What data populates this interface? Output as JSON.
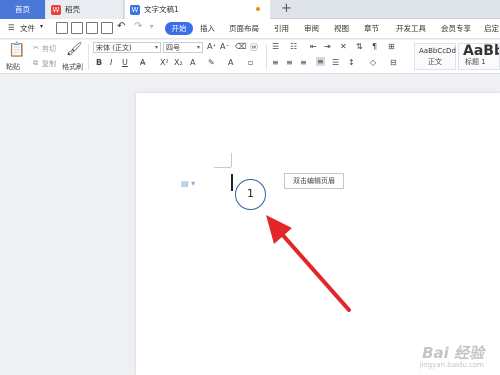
{
  "tabs": {
    "home": "首页",
    "wps": "稻壳",
    "doc": "文字文稿1",
    "plus": "+"
  },
  "menu": {
    "file": "文件",
    "start": "开始",
    "insert": "插入",
    "layout": "页面布局",
    "references": "引用",
    "review": "审阅",
    "view": "视图",
    "section": "章节",
    "devtools": "开发工具",
    "member": "会员专享",
    "more": "启定"
  },
  "ribbon": {
    "paste": "粘贴",
    "cut": "剪切",
    "copy": "复制",
    "format_painter": "格式刷",
    "font_name": "宋体 (正文)",
    "font_size": "四号",
    "style_normal_preview": "AaBbCcDd",
    "style_normal_label": "正文",
    "style_h1_preview": "AaBbA",
    "style_h1_label": "标题 1"
  },
  "document": {
    "callout_number": "1",
    "header_tip": "双击编辑页眉"
  },
  "watermark": {
    "brand": "Bai 经验",
    "url": "jingyan.baidu.com"
  },
  "colors": {
    "accent": "#3a6ee8",
    "home_tab": "#4a78d9",
    "arrow": "#e3262a",
    "callout_ring": "#2f5fa8"
  }
}
